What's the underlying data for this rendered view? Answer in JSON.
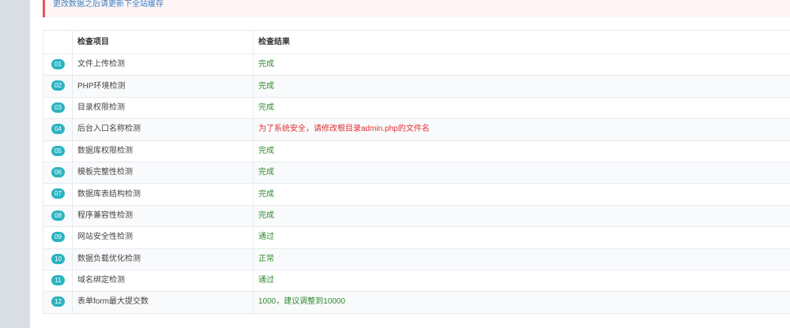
{
  "notice": "更改数据之后请更新下全站缓存",
  "table": {
    "headers": {
      "item": "检查项目",
      "result": "检查结果"
    },
    "rows": [
      {
        "num": "01",
        "item": "文件上传检测",
        "result": "完成",
        "status": "ok"
      },
      {
        "num": "02",
        "item": "PHP环境检测",
        "result": "完成",
        "status": "ok"
      },
      {
        "num": "03",
        "item": "目录权限检测",
        "result": "完成",
        "status": "ok"
      },
      {
        "num": "04",
        "item": "后台入口名称检测",
        "result": "为了系统安全，请修改根目录admin.php的文件名",
        "status": "warn"
      },
      {
        "num": "05",
        "item": "数据库权限检测",
        "result": "完成",
        "status": "ok"
      },
      {
        "num": "06",
        "item": "模板完整性检测",
        "result": "完成",
        "status": "ok"
      },
      {
        "num": "07",
        "item": "数据库表结构检测",
        "result": "完成",
        "status": "ok"
      },
      {
        "num": "08",
        "item": "程序兼容性检测",
        "result": "完成",
        "status": "ok"
      },
      {
        "num": "09",
        "item": "网站安全性检测",
        "result": "通过",
        "status": "ok"
      },
      {
        "num": "10",
        "item": "数据负载优化检测",
        "result": "正常",
        "status": "ok"
      },
      {
        "num": "11",
        "item": "域名绑定检测",
        "result": "通过",
        "status": "ok"
      },
      {
        "num": "12",
        "item": "表单form最大提交数",
        "result": "1000，建议调整到10000",
        "status": "ok"
      }
    ]
  },
  "colors": {
    "ok": "#2e8b2e",
    "warn": "#e03131",
    "badge": "#2bb3c0",
    "notice_border": "#e05b5b",
    "notice_text": "#3c83c2"
  }
}
